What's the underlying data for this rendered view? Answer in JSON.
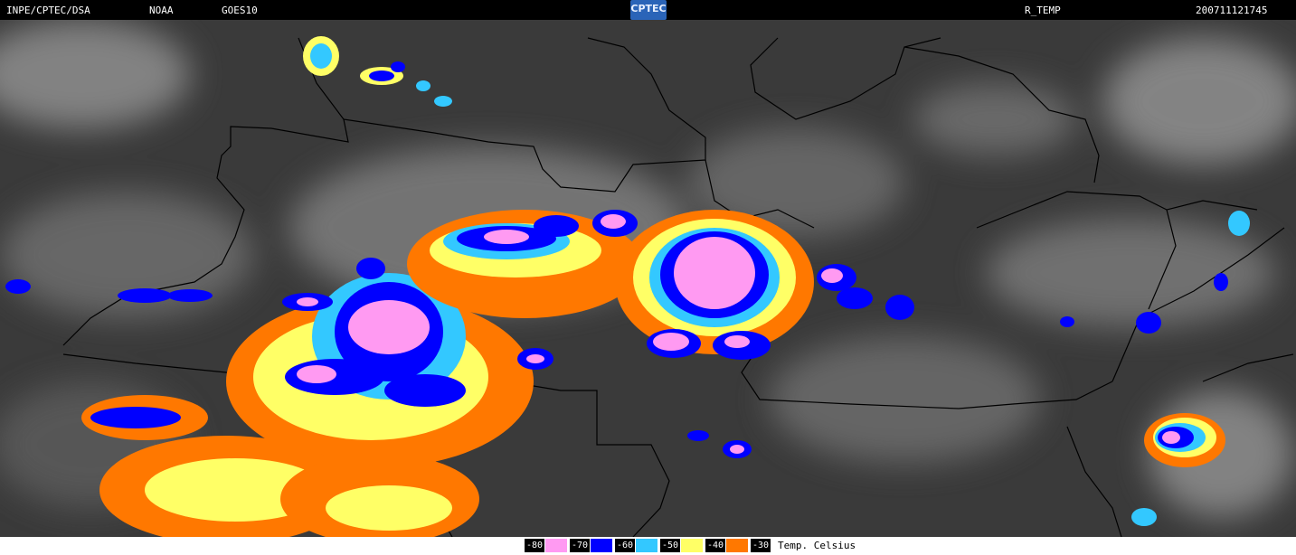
{
  "header": {
    "org": "INPE/CPTEC/DSA",
    "agency": "NOAA",
    "satellite": "GOES10",
    "product": "R_TEMP",
    "timestamp": "200711121745",
    "logo_text": "CPTEC"
  },
  "legend": {
    "unit": "Temp. Celsius",
    "items": [
      {
        "label": "-80",
        "color": "#ff9af2"
      },
      {
        "label": "-70",
        "color": "#0000ff"
      },
      {
        "label": "-60",
        "color": "#33c8ff"
      },
      {
        "label": "-50",
        "color": "#ffff66"
      },
      {
        "label": "-40",
        "color": "#ff7800"
      },
      {
        "label": "-30",
        "color": "#000000"
      }
    ]
  }
}
